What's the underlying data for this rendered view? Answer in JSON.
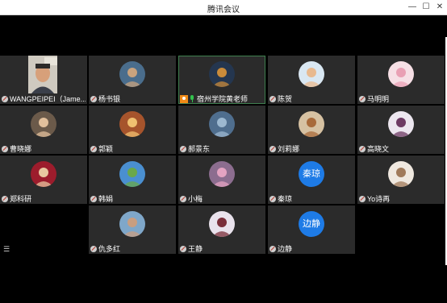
{
  "window": {
    "title": "腾讯会议",
    "minimize_glyph": "—",
    "maximize_glyph": "☐",
    "close_glyph": "✕"
  },
  "side_menu_glyph": "☰",
  "participants": [
    {
      "name": "WANGPEIPEI（Jame...",
      "type": "video",
      "muted": true
    },
    {
      "name": "杨书银",
      "type": "avatar",
      "color": "#4a6d8c",
      "accent": "#c9a37e",
      "muted": true
    },
    {
      "name": "宿州学院黄老师",
      "type": "avatar",
      "color": "#24364f",
      "accent": "#c98b3a",
      "muted": false,
      "host": true,
      "active": true
    },
    {
      "name": "陈贺",
      "type": "avatar",
      "color": "#d9e7f2",
      "accent": "#e8b98f",
      "muted": true
    },
    {
      "name": "马明明",
      "type": "avatar",
      "color": "#f6dfe5",
      "accent": "#e9a0b4",
      "muted": true
    },
    {
      "name": "曹晓娜",
      "type": "avatar",
      "color": "#6b5a4a",
      "accent": "#e2c09c",
      "muted": true
    },
    {
      "name": "郭颖",
      "type": "avatar",
      "color": "#a6542c",
      "accent": "#f0c070",
      "muted": true
    },
    {
      "name": "郝景东",
      "type": "avatar",
      "color": "#4f6e8e",
      "accent": "#9cb8d0",
      "muted": true
    },
    {
      "name": "刘莉娜",
      "type": "avatar",
      "color": "#d6c1a2",
      "accent": "#a86a3a",
      "muted": true
    },
    {
      "name": "高晓文",
      "type": "avatar",
      "color": "#ece6ef",
      "accent": "#6d3a63",
      "muted": true
    },
    {
      "name": "郑科研",
      "type": "avatar",
      "color": "#9c1c2c",
      "accent": "#e8c7a0",
      "muted": true
    },
    {
      "name": "韩娟",
      "type": "avatar",
      "color": "#4a8fd0",
      "accent": "#6aa84a",
      "muted": true
    },
    {
      "name": "小梅",
      "type": "avatar",
      "color": "#8c6d8f",
      "accent": "#e4a3c2",
      "muted": true
    },
    {
      "name": "秦琼",
      "type": "text",
      "initials": "秦琼",
      "muted": true
    },
    {
      "name": "Yo诗再",
      "type": "avatar",
      "color": "#efe8df",
      "accent": "#a07a5a",
      "muted": true
    },
    {
      "name": "仇多红",
      "type": "avatar",
      "color": "#7fa7c9",
      "accent": "#c99e80",
      "muted": true
    },
    {
      "name": "王静",
      "type": "avatar",
      "color": "#e9e2ec",
      "accent": "#7a2e3a",
      "muted": true
    },
    {
      "name": "边静",
      "type": "text",
      "initials": "边静",
      "muted": true
    }
  ]
}
